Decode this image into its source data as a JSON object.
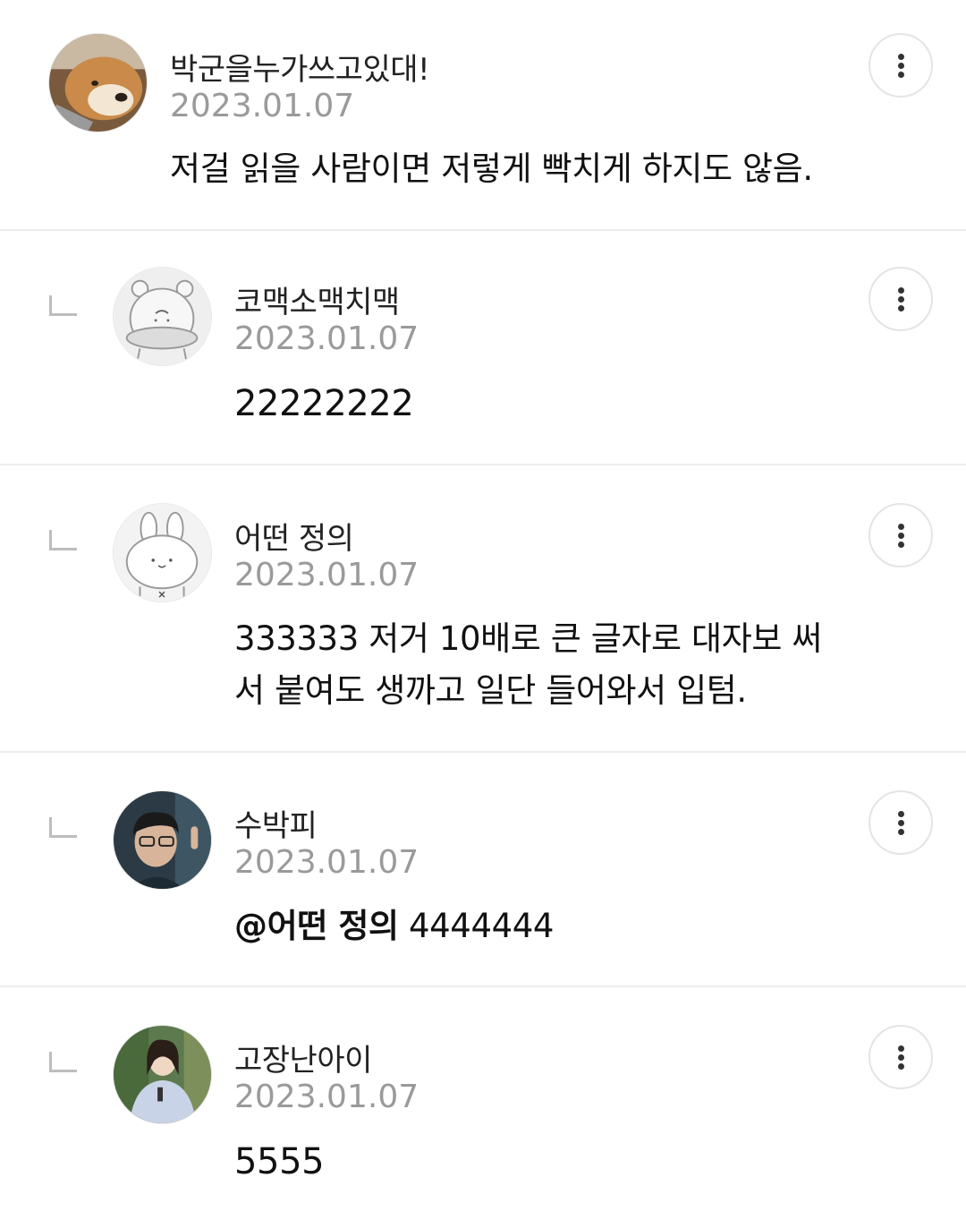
{
  "comments": [
    {
      "author": "박군을누가쓰고있대!",
      "date": "2023.01.07",
      "text": "저걸 읽을 사람이면 저렇게 빡치게 하지도 않음.",
      "is_reply": false
    },
    {
      "author": "코맥소맥치맥",
      "date": "2023.01.07",
      "text": "22222222",
      "is_reply": true
    },
    {
      "author": "어떤 정의",
      "date": "2023.01.07",
      "text_line1": "333333 저거 10배로 큰 글자로 대자보 써",
      "text_line2": "서 붙여도 생까고 일단 들어와서 입텀.",
      "is_reply": true
    },
    {
      "author": "수박피",
      "date": "2023.01.07",
      "mention": "@어떤 정의",
      "text": " 4444444",
      "is_reply": true
    },
    {
      "author": "고장난아이",
      "date": "2023.01.07",
      "text": "5555",
      "is_reply": true
    }
  ],
  "icons": {
    "more": "more-vertical-icon",
    "reply": "reply-corner-icon"
  },
  "colors": {
    "date": "#9a9a9a",
    "divider": "#ececec",
    "reply_mark": "#bdbdbd"
  }
}
